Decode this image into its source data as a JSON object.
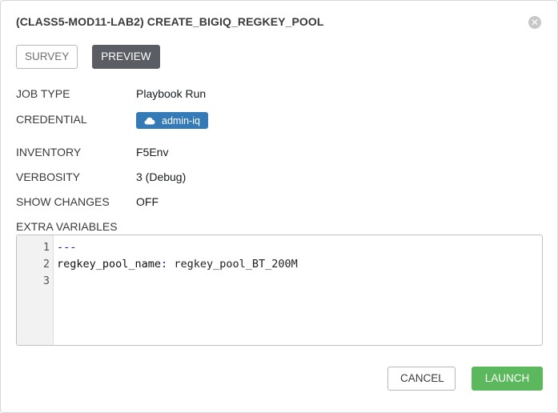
{
  "modal": {
    "title": "(CLASS5-MOD11-LAB2) CREATE_BIGIQ_REGKEY_POOL",
    "close_icon": "close-icon"
  },
  "tabs": [
    {
      "label": "SURVEY",
      "active": false
    },
    {
      "label": "PREVIEW",
      "active": true
    }
  ],
  "details": {
    "job_type": {
      "label": "JOB TYPE",
      "value": "Playbook Run"
    },
    "credential": {
      "label": "CREDENTIAL",
      "value": "admin-iq",
      "icon": "cloud-icon",
      "color": "#337ab7"
    },
    "inventory": {
      "label": "INVENTORY",
      "value": "F5Env"
    },
    "verbosity": {
      "label": "VERBOSITY",
      "value": "3 (Debug)"
    },
    "show_changes": {
      "label": "SHOW CHANGES",
      "value": "OFF"
    }
  },
  "extra_variables": {
    "label": "EXTRA VARIABLES",
    "line_numbers": [
      "1",
      "2",
      "3"
    ],
    "lines": {
      "l1": "---",
      "l2_key": "regkey_pool_name",
      "l2_sep": ":",
      "l2_value": " regkey_pool_BT_200M",
      "l3": ""
    }
  },
  "footer": {
    "cancel_label": "CANCEL",
    "launch_label": "LAUNCH",
    "launch_color": "#5cb85c"
  }
}
